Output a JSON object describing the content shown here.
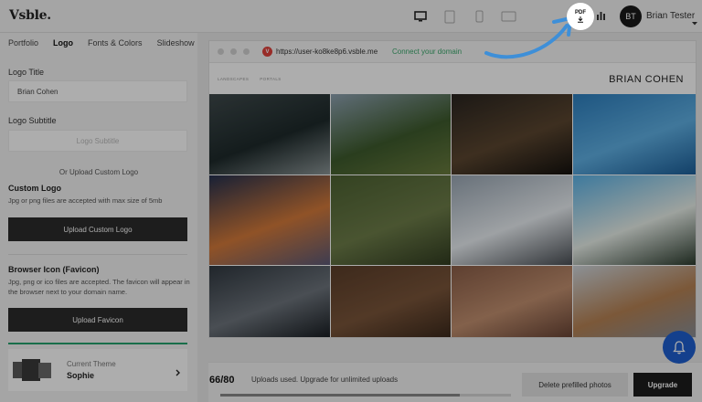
{
  "header": {
    "logo": "Vsble.",
    "devices": [
      "desktop-icon",
      "tablet-icon",
      "phone-icon",
      "wide-screen-icon"
    ],
    "pdf_label": "PDF",
    "user_initials": "BT",
    "user_name": "Brian Tester"
  },
  "panel": {
    "tabs": [
      {
        "label": "Portfolio",
        "active": false
      },
      {
        "label": "Logo",
        "active": true
      },
      {
        "label": "Fonts & Colors",
        "active": false
      },
      {
        "label": "Slideshow",
        "active": false
      }
    ],
    "logo_title_label": "Logo Title",
    "logo_title_value": "Brian Cohen",
    "logo_subtitle_label": "Logo Subtitle",
    "logo_subtitle_placeholder": "Logo Subtitle",
    "or_text": "Or Upload Custom Logo",
    "custom_logo_label": "Custom Logo",
    "custom_logo_hint": "Jpg or png files are accepted with max size of 5mb",
    "upload_logo_button": "Upload Custom Logo",
    "favicon_label": "Browser Icon (Favicon)",
    "favicon_hint": "Jpg, png or ico files are accepted. The favicon will appear in the browser next to your domain name.",
    "upload_favicon_button": "Upload Favicon",
    "theme_caption": "Current Theme",
    "theme_name": "Sophie"
  },
  "preview": {
    "url": "https://user-ko8ke8p6.vsble.me",
    "connect_link": "Connect your domain",
    "nav": [
      "LANDSCAPES",
      "PORTALS"
    ],
    "site_name": "BRIAN COHEN",
    "photos": [
      {
        "subject": "coastal-cliffs",
        "colors": [
          "#3f4a4c",
          "#1e2a2b",
          "#8b9596"
        ]
      },
      {
        "subject": "wetland-ponds",
        "colors": [
          "#8ea2b1",
          "#3e5b2d",
          "#6a7c3e"
        ]
      },
      {
        "subject": "city-aerial-night",
        "colors": [
          "#2a2520",
          "#5b4630",
          "#14110e"
        ]
      },
      {
        "subject": "blue-pool-water",
        "colors": [
          "#2d7fbf",
          "#5fb0e4",
          "#1c5f9a"
        ]
      },
      {
        "subject": "highway-sunset",
        "colors": [
          "#24304f",
          "#d47a3a",
          "#5c5a77"
        ]
      },
      {
        "subject": "grassy-pond",
        "colors": [
          "#4d6232",
          "#6d7d49",
          "#323d21"
        ]
      },
      {
        "subject": "snowy-mountain",
        "colors": [
          "#9aa7b4",
          "#e9eef2",
          "#4a4f55"
        ]
      },
      {
        "subject": "palm-beach",
        "colors": [
          "#5bb3e7",
          "#e8efe9",
          "#2d3d2f"
        ]
      },
      {
        "subject": "steel-bridge",
        "colors": [
          "#303840",
          "#6d747c",
          "#1a1f24"
        ]
      },
      {
        "subject": "plowed-field",
        "colors": [
          "#5b3e2a",
          "#7a553a",
          "#3d2a1c"
        ]
      },
      {
        "subject": "desert-hills",
        "colors": [
          "#8b5e48",
          "#c18f6f",
          "#6a4536"
        ]
      },
      {
        "subject": "skyscrapers",
        "colors": [
          "#cfd6dc",
          "#b68254",
          "#8a8f96"
        ]
      }
    ]
  },
  "bottom": {
    "uploads_count": "66/80",
    "uploads_text": "Uploads used. Upgrade for unlimited uploads",
    "uploads_progress": 0.825,
    "delete_button": "Delete prefilled photos",
    "upgrade_button": "Upgrade"
  },
  "colors": {
    "accent_green": "#26a36d",
    "connect_green": "#3aa86c",
    "bell_blue": "#1e5fd0",
    "arrow_blue": "#3e8fd8"
  }
}
